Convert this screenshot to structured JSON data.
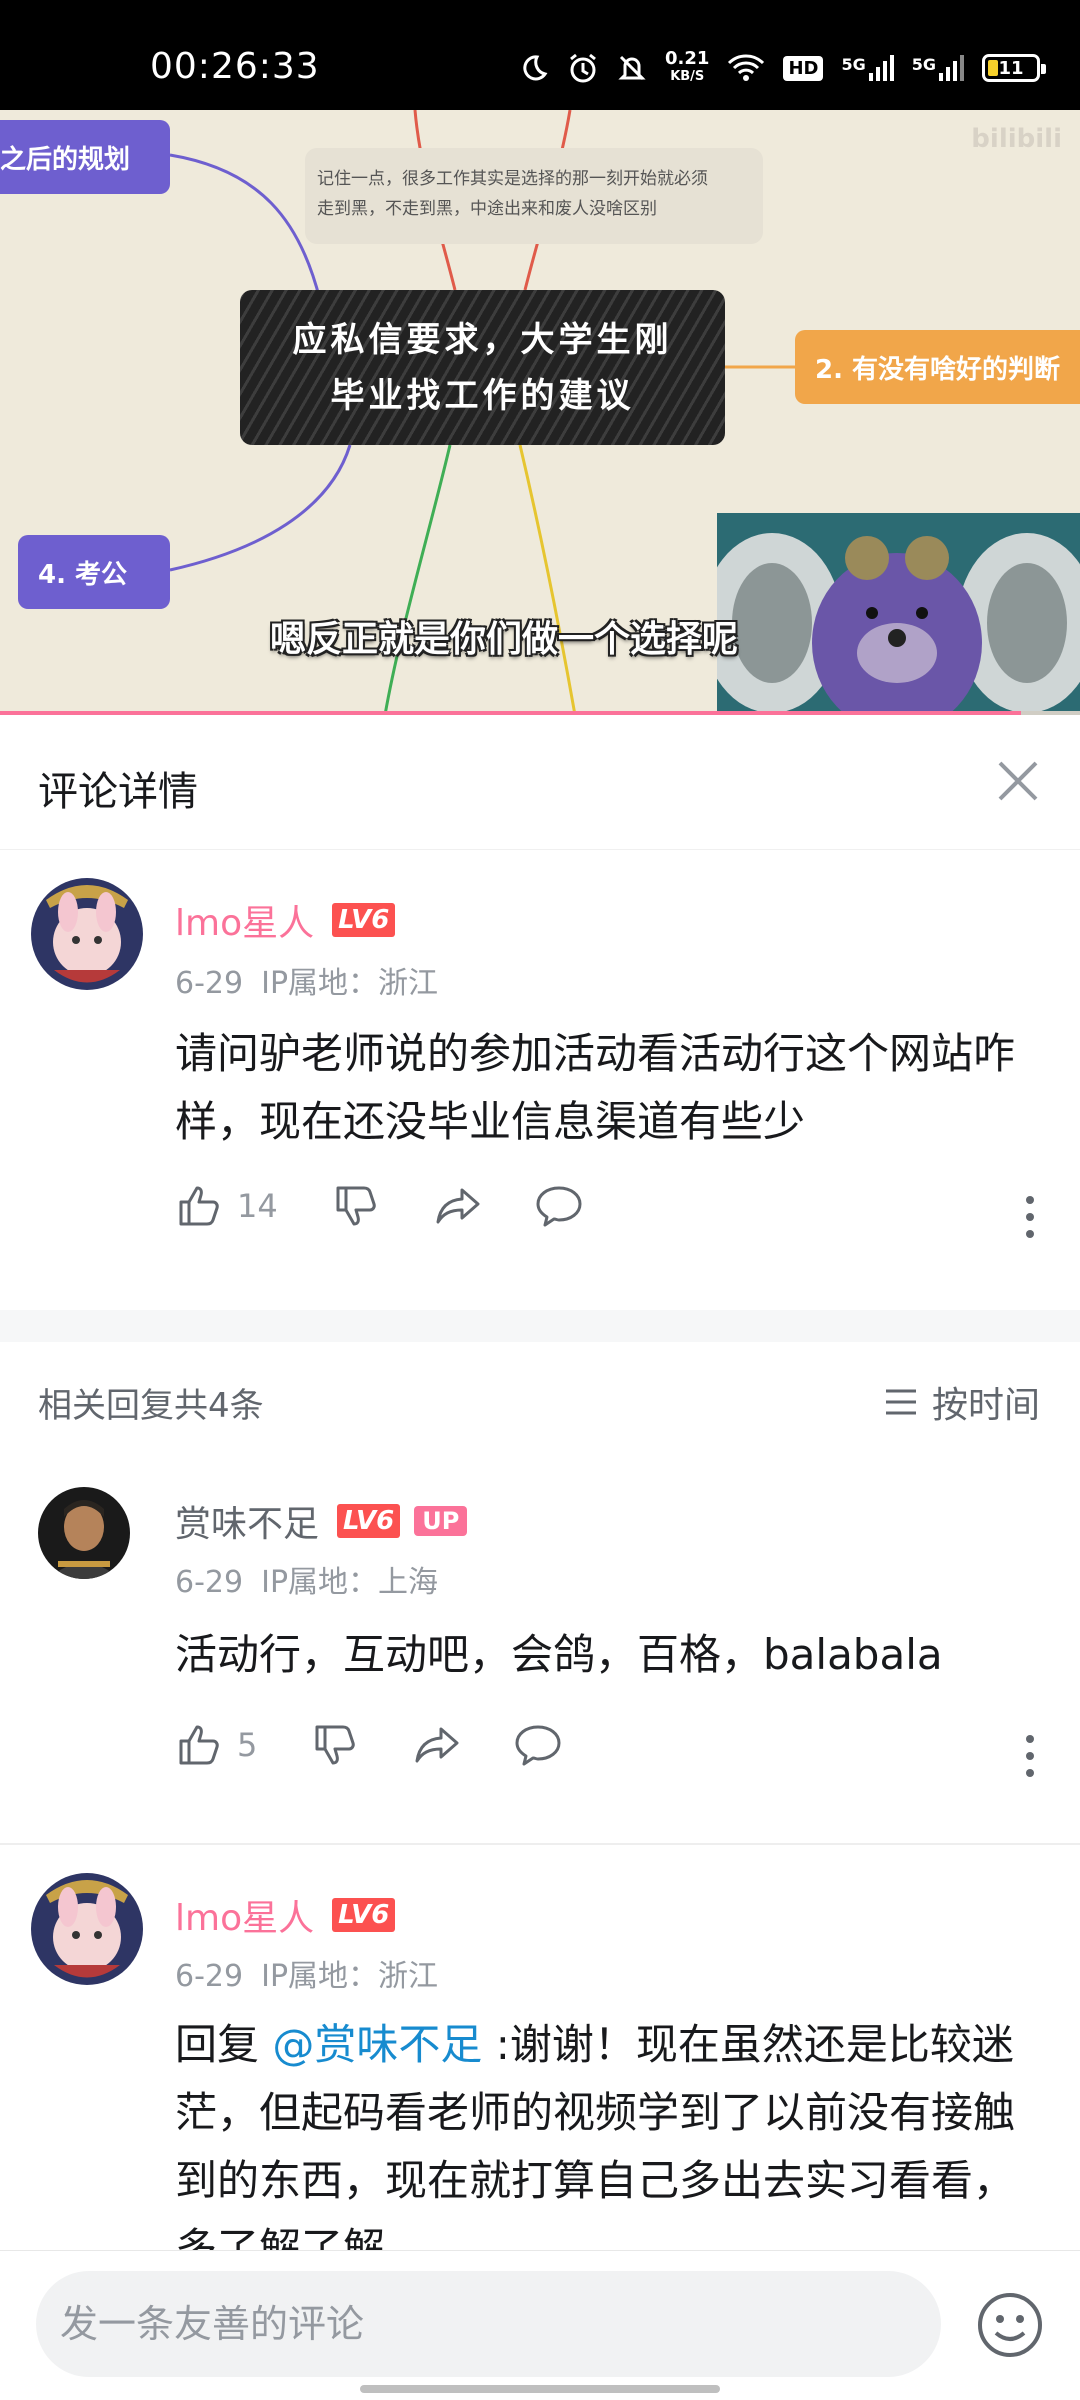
{
  "status_bar": {
    "time": "00:26:33",
    "net_speed_value": "0.21",
    "net_speed_unit": "KB/S",
    "hd_label": "HD",
    "sim1": "5G",
    "sim2": "5G",
    "battery": "11"
  },
  "video": {
    "mindmap_center_line1": "应私信要求，大学生刚",
    "mindmap_center_line2": "毕业找工作的建议",
    "mindmap_note_line1": "记住一点，很多工作其实是选择的那一刻开始就必须",
    "mindmap_note_line2": "走到黑，不走到黑，中途出来和废人没啥区别",
    "node_left_top": "之后的规划",
    "node_right": "2. 有没有啥好的判断",
    "node_left_bottom": "4. 考公",
    "subtitle": "嗯反正就是你们做一个选择呢",
    "progress_fraction": 0.945
  },
  "detail": {
    "title": "评论详情"
  },
  "main_comment": {
    "username": "lmo星人",
    "level": "LV6",
    "date": "6-29",
    "ip": "IP属地：浙江",
    "content": "请问驴老师说的参加活动看活动行这个网站咋样，现在还没毕业信息渠道有些少",
    "likes": "14"
  },
  "replies_header": {
    "count_text": "相关回复共4条",
    "sort_label": "按时间"
  },
  "replies": [
    {
      "username": "赏味不足",
      "level": "LV6",
      "badge": "UP",
      "date": "6-29",
      "ip": "IP属地：上海",
      "content": "活动行，互动吧，会鸽，百格，balabala",
      "likes": "5"
    },
    {
      "username": "lmo星人",
      "level": "LV6",
      "date": "6-29",
      "ip": "IP属地：浙江",
      "reply_prefix": "回复 ",
      "mention": "@赏味不足",
      "content": " :谢谢！现在虽然还是比较迷茫，但起码看老师的视频学到了以前没有接触到的东西，现在就打算自己多出去实习看看，多了解了解"
    }
  ],
  "bottom": {
    "input_placeholder": "发一条友善的评论"
  },
  "colors": {
    "brand_pink": "#fb7299",
    "level_red": "#fc5150",
    "mention_blue": "#178bcf"
  }
}
